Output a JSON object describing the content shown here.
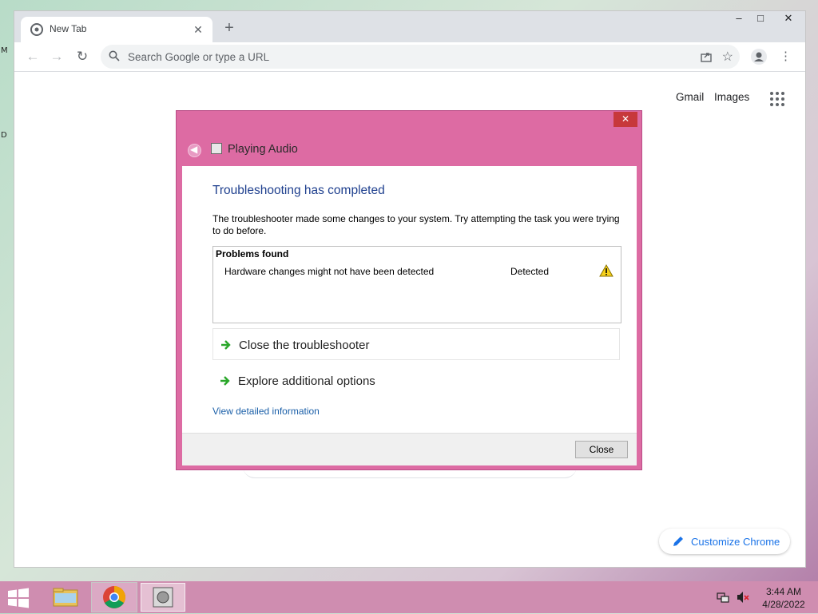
{
  "desktop": {
    "glyph_top": "M",
    "glyph_mid": "D"
  },
  "browser": {
    "tab_title": "New Tab",
    "omnibox_placeholder": "Search Google or type a URL",
    "ntp_links": {
      "gmail": "Gmail",
      "images": "Images"
    },
    "customize_label": "Customize Chrome"
  },
  "dialog": {
    "title": "Playing Audio",
    "heading": "Troubleshooting has completed",
    "description": "The troubleshooter made some changes to your system. Try attempting the task you were trying to do before.",
    "problems_header": "Problems found",
    "problems": [
      {
        "name": "Hardware changes might not have been detected",
        "status": "Detected",
        "icon": "warning-icon"
      }
    ],
    "options": [
      {
        "label": "Close the troubleshooter",
        "icon": "green-arrow-icon"
      },
      {
        "label": "Explore additional options",
        "icon": "green-arrow-icon"
      }
    ],
    "details_link": "View detailed information",
    "close_button": "Close",
    "close_x": "✕"
  },
  "taskbar": {
    "time": "3:44 AM",
    "date": "4/28/2022"
  },
  "colors": {
    "dialog_frame": "#dd6ba3",
    "heading_blue": "#1e3f8e",
    "link_blue": "#1a5fa8",
    "chrome_accent": "#1a73e8",
    "taskbar": "#cf8db0"
  }
}
